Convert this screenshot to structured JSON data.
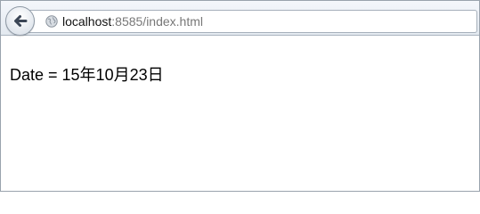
{
  "browser": {
    "address_bar": {
      "host": "localhost",
      "rest": ":8585/index.html"
    }
  },
  "page": {
    "text": "Date = 15年10月23日"
  },
  "icons": {
    "back": "back-arrow-icon",
    "site": "globe-icon"
  },
  "colors": {
    "url_host": "#111111",
    "url_rest": "#777777",
    "toolbar_bg": "#e9eef4"
  }
}
